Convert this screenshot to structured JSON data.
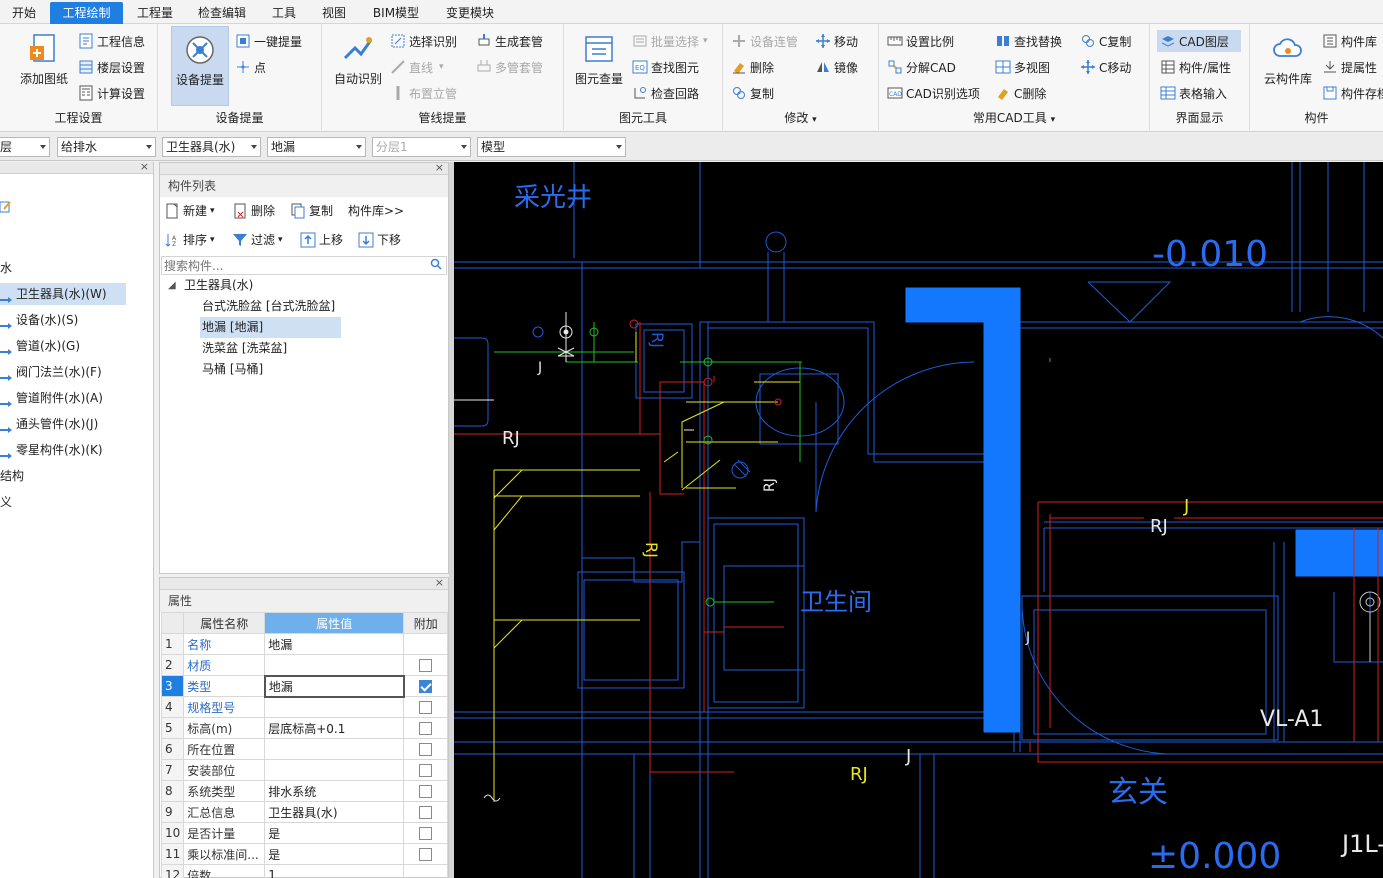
{
  "menu": {
    "tabs": [
      {
        "label": "开始",
        "active": false
      },
      {
        "label": "工程绘制",
        "active": true
      },
      {
        "label": "工程量",
        "active": false
      },
      {
        "label": "检查编辑",
        "active": false
      },
      {
        "label": "工具",
        "active": false
      },
      {
        "label": "视图",
        "active": false
      },
      {
        "label": "BIM模型",
        "active": false
      },
      {
        "label": "变更模块",
        "active": false
      }
    ]
  },
  "ribbon": {
    "project_settings": {
      "group_label": "工程设置",
      "add_drawing": "添加图纸",
      "project_info": "工程信息",
      "floor_settings": "楼层设置",
      "calc_settings": "计算设置"
    },
    "device_takeoff": {
      "group_label": "设备提量",
      "device_takeoff_btn": "设备提量",
      "one_click_takeoff": "一键提量",
      "point": "点"
    },
    "pipe_takeoff": {
      "group_label": "管线提量",
      "auto_recognize": "自动识别",
      "select_recognize": "选择识别",
      "line": "直线",
      "layout_riser": "布置立管",
      "generate_fittings": "生成套管",
      "multi_pipe_fittings": "多管套管"
    },
    "element_tools": {
      "group_label": "图元工具",
      "element_takeoff": "图元查量",
      "batch_select": "批量选择",
      "find_element": "查找图元",
      "check_loop": "检查回路"
    },
    "modify": {
      "group_label": "修改",
      "device_connect_pipe": "设备连管",
      "delete": "删除",
      "copy": "复制",
      "move": "移动",
      "mirror": "镜像"
    },
    "cad_tools": {
      "group_label": "常用CAD工具",
      "set_scale": "设置比例",
      "split_cad": "分解CAD",
      "cad_options": "CAD识别选项",
      "find_replace": "查找替换",
      "multi_view": "多视图",
      "c_delete": "C删除",
      "c_copy": "C复制",
      "c_move": "C移动"
    },
    "ui_display": {
      "group_label": "界面显示",
      "cad_layers": "CAD图层",
      "component_props": "构件/属性",
      "table_input": "表格输入"
    },
    "component": {
      "group_label": "构件",
      "cloud_library": "云构件库",
      "component_library": "构件库",
      "extract_props": "提属性",
      "component_store": "构件存档"
    }
  },
  "selectors": {
    "floor": "层",
    "discipline": "给排水",
    "category": "卫生器具(水)",
    "component": "地漏",
    "sublayer": "分层1",
    "mode": "模型"
  },
  "left_panel": {
    "items": [
      {
        "label": "水",
        "selected": false
      },
      {
        "label": "卫生器具(水)(W)",
        "selected": true
      },
      {
        "label": "设备(水)(S)",
        "selected": false
      },
      {
        "label": "管道(水)(G)",
        "selected": false
      },
      {
        "label": "阀门法兰(水)(F)",
        "selected": false
      },
      {
        "label": "管道附件(水)(A)",
        "selected": false
      },
      {
        "label": "通头管件(水)(J)",
        "selected": false
      },
      {
        "label": "零星构件(水)(K)",
        "selected": false
      },
      {
        "label": "结构",
        "selected": false
      },
      {
        "label": "义",
        "selected": false
      }
    ]
  },
  "component_list": {
    "title": "构件列表",
    "toolbar": {
      "new": "新建",
      "delete": "删除",
      "copy": "复制",
      "library": "构件库>>",
      "sort": "排序",
      "filter": "过滤",
      "move_up": "上移",
      "move_down": "下移"
    },
    "search_placeholder": "搜索构件...",
    "tree_root": "卫生器具(水)",
    "items": [
      {
        "label": "台式洗脸盆 [台式洗脸盆]",
        "selected": false
      },
      {
        "label": "地漏 [地漏]",
        "selected": true
      },
      {
        "label": "洗菜盆 [洗菜盆]",
        "selected": false
      },
      {
        "label": "马桶 [马桶]",
        "selected": false
      }
    ]
  },
  "properties": {
    "title": "属性",
    "headers": {
      "name": "属性名称",
      "value": "属性值",
      "extra": "附加"
    },
    "rows": [
      {
        "num": "1",
        "name": "名称",
        "value": "地漏",
        "checked": null,
        "blue": true
      },
      {
        "num": "2",
        "name": "材质",
        "value": "",
        "checked": false,
        "blue": true
      },
      {
        "num": "3",
        "name": "类型",
        "value": "地漏",
        "checked": true,
        "blue": true
      },
      {
        "num": "4",
        "name": "规格型号",
        "value": "",
        "checked": false,
        "blue": true
      },
      {
        "num": "5",
        "name": "标高(m)",
        "value": "层底标高+0.1",
        "checked": false,
        "blue": false
      },
      {
        "num": "6",
        "name": "所在位置",
        "value": "",
        "checked": false,
        "blue": false
      },
      {
        "num": "7",
        "name": "安装部位",
        "value": "",
        "checked": false,
        "blue": false
      },
      {
        "num": "8",
        "name": "系统类型",
        "value": "排水系统",
        "checked": false,
        "blue": false
      },
      {
        "num": "9",
        "name": "汇总信息",
        "value": "卫生器具(水)",
        "checked": false,
        "blue": false
      },
      {
        "num": "10",
        "name": "是否计量",
        "value": "是",
        "checked": false,
        "blue": false
      },
      {
        "num": "11",
        "name": "乘以标准间...",
        "value": "是",
        "checked": false,
        "blue": false
      },
      {
        "num": "12",
        "name": "倍数",
        "value": "1",
        "checked": null,
        "blue": false
      }
    ]
  },
  "cad": {
    "labels": {
      "light_well": "采光井",
      "elev_neg": "-0.010",
      "rj": "RJ",
      "j": "J",
      "bathroom": "卫生间",
      "vl": "VL-A1",
      "entrance": "玄关",
      "elev_zero": "±0.000",
      "jl": "J1L-"
    },
    "colors": {
      "background": "#000000",
      "wall": "#1e5bd6",
      "hot": "#d22020",
      "cold": "#20c020",
      "yellow": "#e6e61e",
      "column": "#1478ff",
      "text_blue": "#2a6cf0",
      "white": "#e8e8e8"
    }
  }
}
